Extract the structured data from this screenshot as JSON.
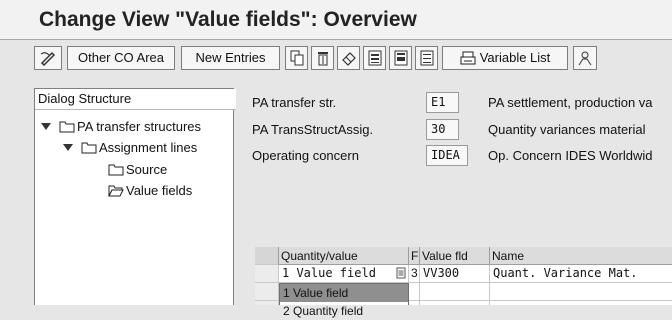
{
  "window": {
    "title": "Change View \"Value fields\": Overview"
  },
  "toolbar": {
    "other_co_area": "Other CO Area",
    "new_entries": "New Entries",
    "variable_list": "Variable List"
  },
  "tree": {
    "header": "Dialog Structure",
    "items": [
      {
        "label": "PA transfer structures"
      },
      {
        "label": "Assignment lines"
      },
      {
        "label": "Source"
      },
      {
        "label": "Value fields"
      }
    ]
  },
  "form": {
    "fields": [
      {
        "label": "PA transfer str.",
        "value": "E1",
        "description": "PA settlement, production va"
      },
      {
        "label": "PA TransStructAssig.",
        "value": "30",
        "description": "Quantity variances material"
      },
      {
        "label": "Operating concern",
        "value": "IDEA",
        "description": "Op. Concern IDES Worldwid"
      }
    ]
  },
  "table": {
    "headers": [
      "Quantity/value",
      "F",
      "Value fld",
      "Name"
    ],
    "rows": [
      {
        "qty_value": "1 Value field",
        "f": "3",
        "value_fld": "VV300",
        "name": "Quant. Variance Mat."
      }
    ]
  },
  "dropdown": {
    "options": [
      "1 Value field",
      "2 Quantity field"
    ],
    "selected_index": 0
  },
  "colors": {
    "selection": "#8f8f8f",
    "window_bg": "#e6e6e6"
  }
}
